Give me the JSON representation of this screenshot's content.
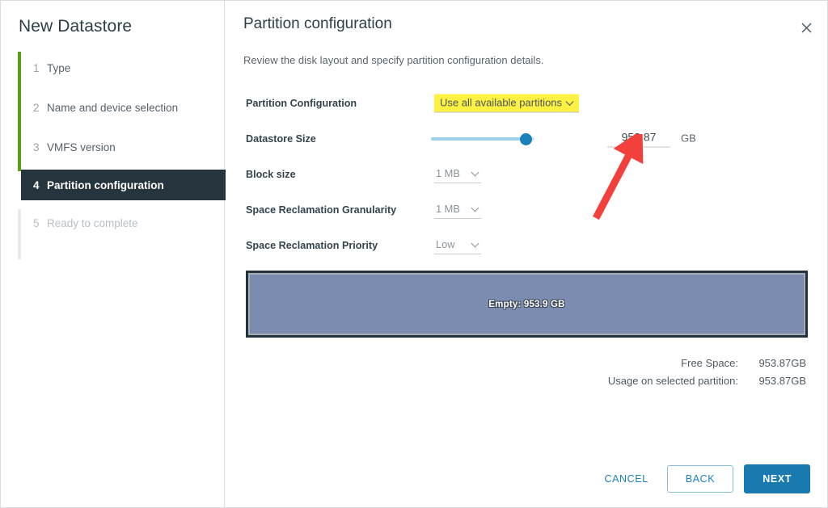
{
  "wizard": {
    "title": "New Datastore",
    "steps": [
      {
        "num": "1",
        "label": "Type",
        "state": "done"
      },
      {
        "num": "2",
        "label": "Name and device selection",
        "state": "done"
      },
      {
        "num": "3",
        "label": "VMFS version",
        "state": "done"
      },
      {
        "num": "4",
        "label": "Partition configuration",
        "state": "active"
      },
      {
        "num": "5",
        "label": "Ready to complete",
        "state": "pending"
      }
    ]
  },
  "page": {
    "title": "Partition configuration",
    "subtitle": "Review the disk layout and specify partition configuration details.",
    "close_icon": "close-icon"
  },
  "form": {
    "partition_configuration": {
      "label": "Partition Configuration",
      "value": "Use all available partitions",
      "highlight_color": "#fdf141"
    },
    "datastore_size": {
      "label": "Datastore Size",
      "value": "953.87",
      "unit": "GB",
      "slider_percent": 100
    },
    "block_size": {
      "label": "Block size",
      "value": "1 MB"
    },
    "space_reclamation_granularity": {
      "label": "Space Reclamation Granularity",
      "value": "1 MB"
    },
    "space_reclamation_priority": {
      "label": "Space Reclamation Priority",
      "value": "Low"
    }
  },
  "disk_layout": {
    "segment_label": "Empty: 953.9 GB",
    "fill_color": "#7b8cb0"
  },
  "summary": {
    "free_space_label": "Free Space:",
    "free_space_value": "953.87GB",
    "usage_label": "Usage on selected partition:",
    "usage_value": "953.87GB"
  },
  "footer": {
    "cancel": "CANCEL",
    "back": "BACK",
    "next": "NEXT",
    "accent_color": "#1a7ab0"
  },
  "annotation": {
    "arrow_color": "#f2413c",
    "points_at": "datastore-size-input"
  }
}
